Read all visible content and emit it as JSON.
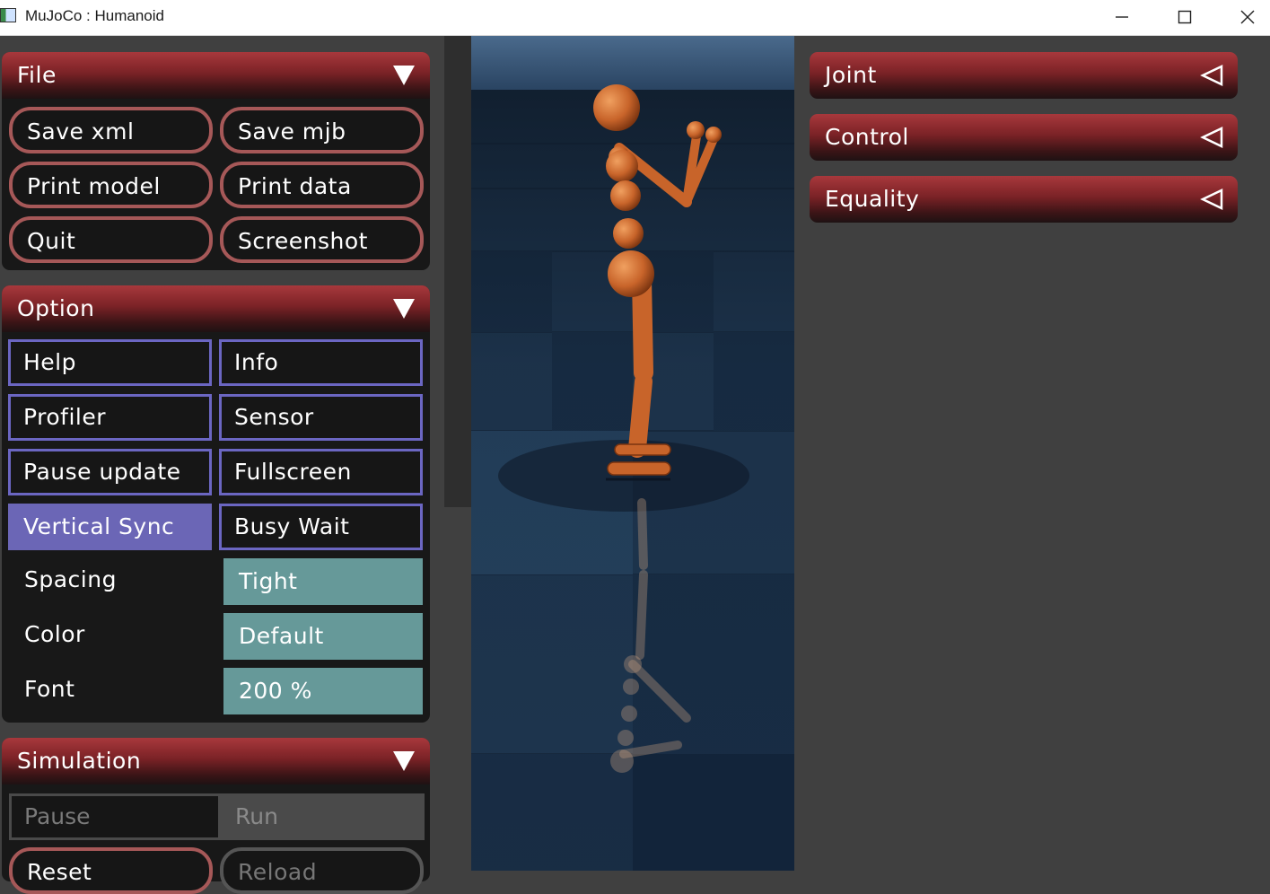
{
  "window": {
    "title": "MuJoCo : Humanoid"
  },
  "file": {
    "title": "File",
    "buttons": {
      "save_xml": "Save xml",
      "save_mjb": "Save mjb",
      "print_model": "Print model",
      "print_data": "Print data",
      "quit": "Quit",
      "screenshot": "Screenshot"
    }
  },
  "option": {
    "title": "Option",
    "toggles": {
      "help": "Help",
      "info": "Info",
      "profiler": "Profiler",
      "sensor": "Sensor",
      "pause_update": "Pause update",
      "fullscreen": "Fullscreen",
      "vertical_sync": "Vertical Sync",
      "busy_wait": "Busy Wait"
    },
    "active_toggle": "Vertical Sync",
    "selects": {
      "spacing_label": "Spacing",
      "spacing_value": "Tight",
      "color_label": "Color",
      "color_value": "Default",
      "font_label": "Font",
      "font_value": "200 %"
    }
  },
  "simulation": {
    "title": "Simulation",
    "radio": {
      "pause": "Pause",
      "run": "Run"
    },
    "buttons": {
      "reset": "Reset",
      "reload": "Reload"
    }
  },
  "right_panel": {
    "joint": "Joint",
    "control": "Control",
    "equality": "Equality"
  },
  "colors": {
    "header_red": "#a8383c",
    "toggle_border": "#6b66c2",
    "button_border": "#a65858",
    "select_teal": "#669999",
    "figure_orange": "#c8642a",
    "floor_blue": "#2a4a6a"
  }
}
